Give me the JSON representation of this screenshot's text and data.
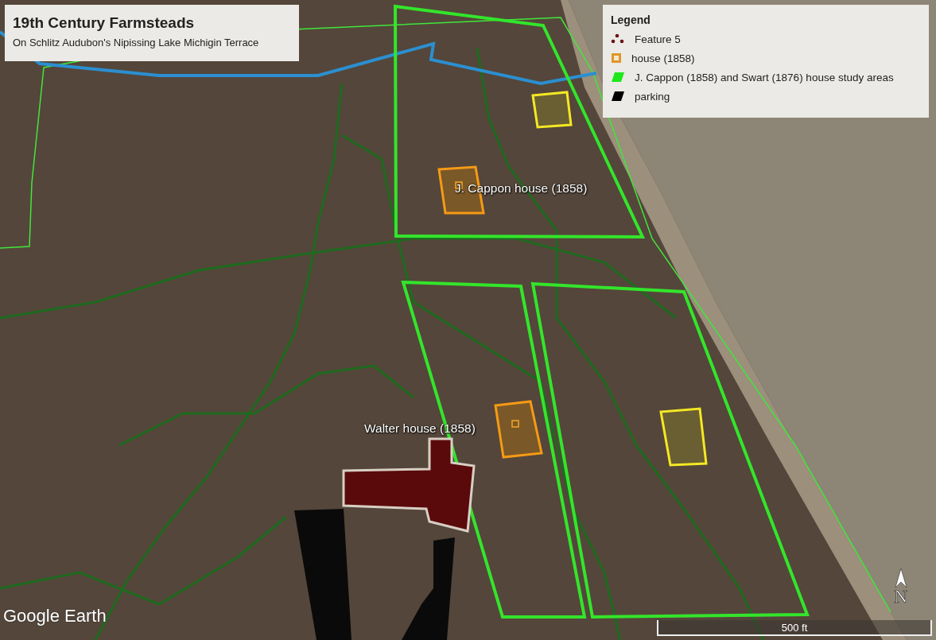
{
  "title_panel": {
    "title": "19th Century Farmsteads",
    "subtitle": "On Schlitz Audubon's Nipissing Lake Michigin Terrace"
  },
  "legend": {
    "heading": "Legend",
    "items": [
      {
        "kind": "feature",
        "label": "Feature 5"
      },
      {
        "kind": "house",
        "label": "house (1858)"
      },
      {
        "kind": "study_area",
        "label": "J. Cappon (1858) and Swart (1876) house study areas"
      },
      {
        "kind": "parking",
        "label": "parking"
      }
    ]
  },
  "map_labels": [
    {
      "text": "J. Cappon house (1858)"
    },
    {
      "text": "Walter house (1858)"
    }
  ],
  "scale_bar": {
    "label": "500 ft"
  },
  "compass": {
    "label": "N"
  },
  "logo": {
    "text": "Google Earth"
  }
}
